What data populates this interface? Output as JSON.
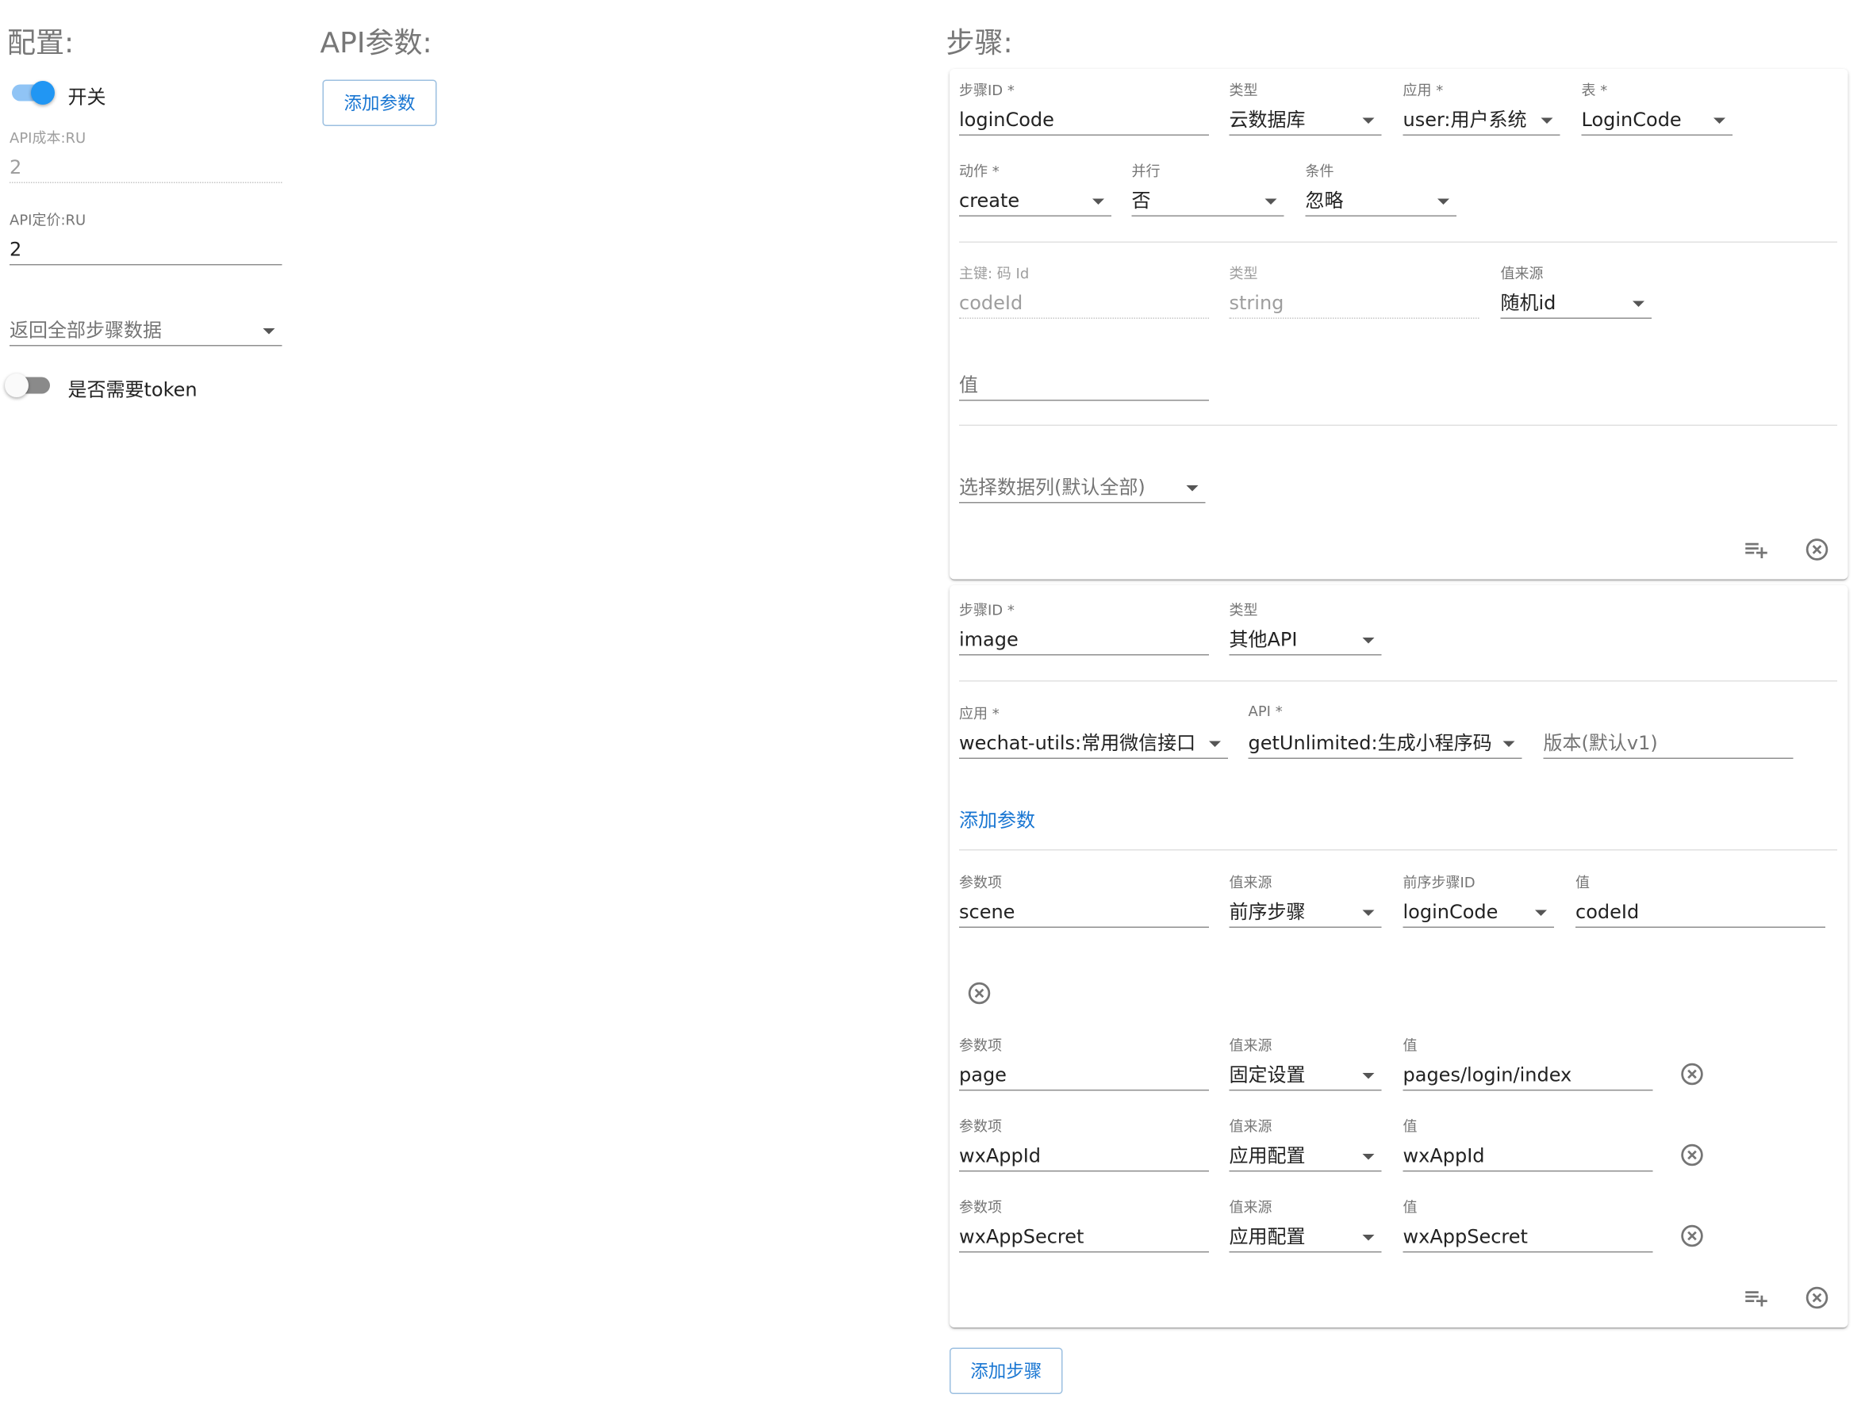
{
  "config": {
    "title": "配置:",
    "switch_label": "开关",
    "switch_on": true,
    "cost": {
      "label": "API成本:RU",
      "value": "2"
    },
    "price": {
      "label": "API定价:RU",
      "value": "2"
    },
    "return_select": "返回全部步骤数据",
    "token_label": "是否需要token",
    "token_on": false
  },
  "api_params": {
    "title": "API参数:",
    "add_button": "添加参数"
  },
  "steps": {
    "title": "步骤:",
    "add_step_button": "添加步骤",
    "step1": {
      "step_id": {
        "label": "步骤ID *",
        "value": "loginCode"
      },
      "type": {
        "label": "类型",
        "value": "云数据库"
      },
      "app": {
        "label": "应用 *",
        "value": "user:用户系统"
      },
      "table": {
        "label": "表 *",
        "value": "LoginCode"
      },
      "action": {
        "label": "动作 *",
        "value": "create"
      },
      "parallel": {
        "label": "并行",
        "value": "否"
      },
      "condition": {
        "label": "条件",
        "value": "忽略"
      },
      "pk": {
        "label": "主键: 码 Id",
        "value": "codeId"
      },
      "pk_type": {
        "label": "类型",
        "value": "string"
      },
      "value_source": {
        "label": "值来源",
        "value": "随机id"
      },
      "value_placeholder": "值",
      "columns_select": "选择数据列(默认全部)"
    },
    "step2": {
      "step_id": {
        "label": "步骤ID *",
        "value": "image"
      },
      "type": {
        "label": "类型",
        "value": "其他API"
      },
      "app": {
        "label": "应用 *",
        "value": "wechat-utils:常用微信接口"
      },
      "api": {
        "label": "API *",
        "value": "getUnlimited:生成小程序码"
      },
      "version_placeholder": "版本(默认v1)",
      "add_param_link": "添加参数",
      "params": [
        {
          "param_label": "参数项",
          "param": "scene",
          "source_label": "值来源",
          "source": "前序步骤",
          "prev_label": "前序步骤ID",
          "prev": "loginCode",
          "value_label": "值",
          "value": "codeId"
        },
        {
          "param_label": "参数项",
          "param": "page",
          "source_label": "值来源",
          "source": "固定设置",
          "value_label": "值",
          "value": "pages/login/index"
        },
        {
          "param_label": "参数项",
          "param": "wxAppId",
          "source_label": "值来源",
          "source": "应用配置",
          "value_label": "值",
          "value": "wxAppId"
        },
        {
          "param_label": "参数项",
          "param": "wxAppSecret",
          "source_label": "值来源",
          "source": "应用配置",
          "value_label": "值",
          "value": "wxAppSecret"
        }
      ]
    }
  },
  "icons": {
    "remove": "circle-x-icon",
    "add_row": "playlist-add-icon",
    "dropdown": "caret-down-icon"
  },
  "colors": {
    "primary": "#2196f3",
    "link": "#1976d2"
  }
}
